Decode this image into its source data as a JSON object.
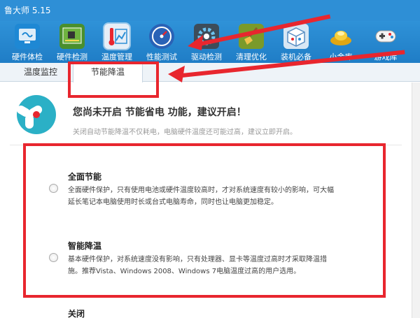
{
  "app": {
    "title": "鲁大师 5.15"
  },
  "toolbar": {
    "items": [
      {
        "label": "硬件体检",
        "icon": "monitor-icon",
        "color": "#1e88d4"
      },
      {
        "label": "硬件检测",
        "icon": "circuit-board-icon",
        "color": "#4a8f2d"
      },
      {
        "label": "温度管理",
        "icon": "thermometer-icon",
        "color": "#e6eef7"
      },
      {
        "label": "性能测试",
        "icon": "gauge-icon",
        "color": "#2a62b6"
      },
      {
        "label": "驱动检测",
        "icon": "gear-icon",
        "color": "#3d4c59"
      },
      {
        "label": "清理优化",
        "icon": "broom-icon",
        "color": "#7a9a2a"
      },
      {
        "label": "装机必备",
        "icon": "box-icon",
        "color": "#d8e7f4"
      },
      {
        "label": "小金库",
        "icon": "gold-ingot-icon",
        "color": "#f2c12e"
      },
      {
        "label": "游戏库",
        "icon": "gamepad-icon",
        "color": "#eeeeee"
      }
    ]
  },
  "subtabs": {
    "monitor": "温度监控",
    "energy": "节能降温"
  },
  "banner": {
    "headline": "您尚未开启 节能省电 功能，建议开启！",
    "description": "关闭自动节能降温不仅耗电，电脑硬件温度还可能过高，建议立即开启。"
  },
  "options": {
    "full": {
      "title": "全面节能",
      "line1": "全面硬件保护，只有使用电池或硬件温度较高时，才对系统速度有较小的影响，可大幅",
      "line2": "延长笔记本电脑使用时长或台式电脑寿命，同时也让电脑更加稳定。"
    },
    "smart": {
      "title": "智能降温",
      "line1": "基本硬件保护，对系统速度没有影响，只有处理器、显卡等温度过高时才采取降温措",
      "line2": "施。推荐Vista、Windows 2008、Windows 7电脑温度过高的用户选用。"
    },
    "off": {
      "title": "关闭"
    }
  },
  "colors": {
    "accent": "#2e8fd6",
    "highlight": "#e8262e"
  }
}
